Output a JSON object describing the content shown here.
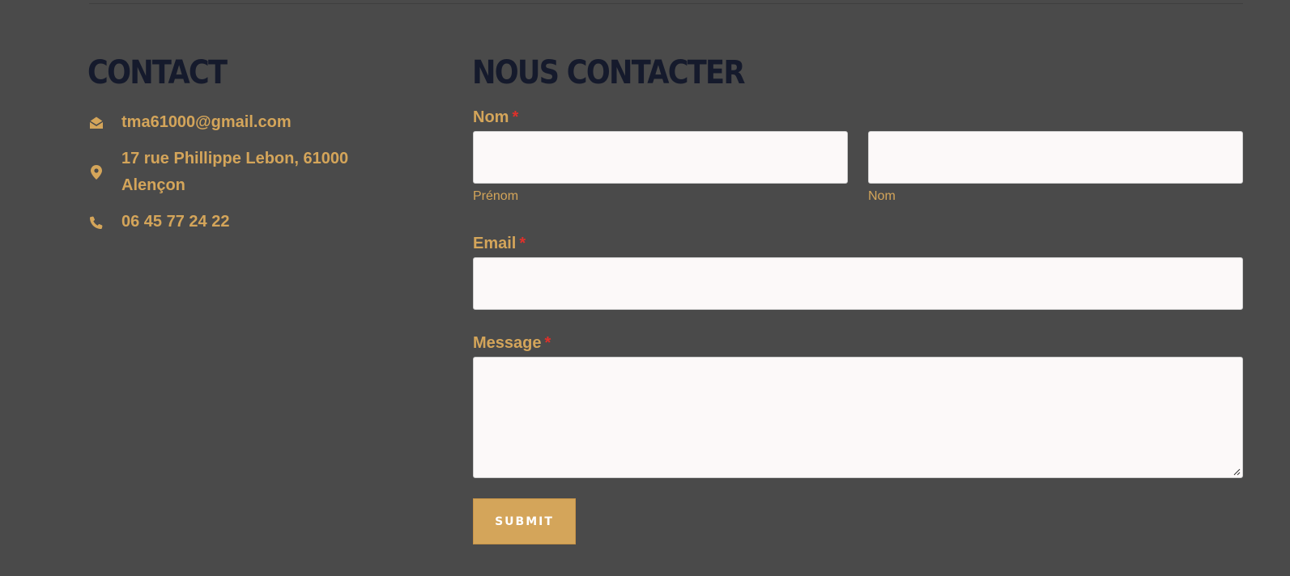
{
  "contact": {
    "heading": "CONTACT",
    "email": "tma61000@gmail.com",
    "address": "17 rue Phillippe Lebon, 61000 Alençon",
    "phone": "06 45 77 24 22",
    "icons": {
      "email": "envelope-open-icon",
      "address": "map-pin-icon",
      "phone": "phone-icon"
    }
  },
  "form": {
    "heading": "NOUS CONTACTER",
    "name_label": "Nom",
    "required_mark": "*",
    "first_name_sublabel": "Prénom",
    "last_name_sublabel": "Nom",
    "first_name_value": "",
    "last_name_value": "",
    "email_label": "Email",
    "email_value": "",
    "message_label": "Message",
    "message_value": "",
    "submit_label": "SUBMIT"
  },
  "colors": {
    "background": "#4a4a4a",
    "accent": "#d4a55a",
    "heading": "#151a2c",
    "required": "#e0302a",
    "field_background": "#fcf9f9"
  }
}
